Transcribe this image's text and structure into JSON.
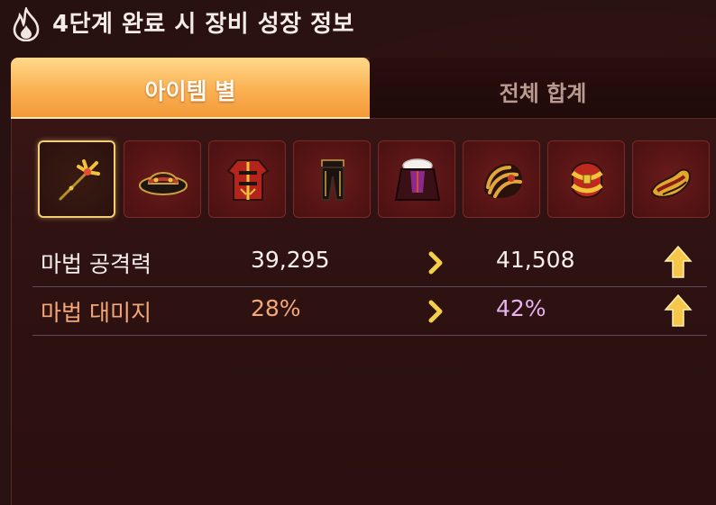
{
  "header": {
    "title": "4단계 완료 시 장비 성장 정보",
    "icon": "flame-icon"
  },
  "tabs": [
    {
      "label": "아이템 별",
      "active": true
    },
    {
      "label": "전체 합계",
      "active": false
    }
  ],
  "equipment_slots": [
    {
      "icon": "staff-icon",
      "selected": true
    },
    {
      "icon": "hat-icon",
      "selected": false
    },
    {
      "icon": "robe-icon",
      "selected": false
    },
    {
      "icon": "pants-icon",
      "selected": false
    },
    {
      "icon": "cape-icon",
      "selected": false
    },
    {
      "icon": "gloves-icon",
      "selected": false
    },
    {
      "icon": "belt-icon",
      "selected": false
    },
    {
      "icon": "shoes-icon",
      "selected": false
    }
  ],
  "stats": [
    {
      "label": "마법 공격력",
      "before": "39,295",
      "after": "41,508",
      "trend": "up"
    },
    {
      "label": "마법 대미지",
      "before": "28%",
      "after": "42%",
      "trend": "up"
    }
  ],
  "colors": {
    "tab_active": "#fbb052",
    "slot_selected_border": "#f3cf73",
    "stat2_label": "#f4a777",
    "stat2_after": "#e6b3f1",
    "arrow_up": "#f6c64a"
  }
}
